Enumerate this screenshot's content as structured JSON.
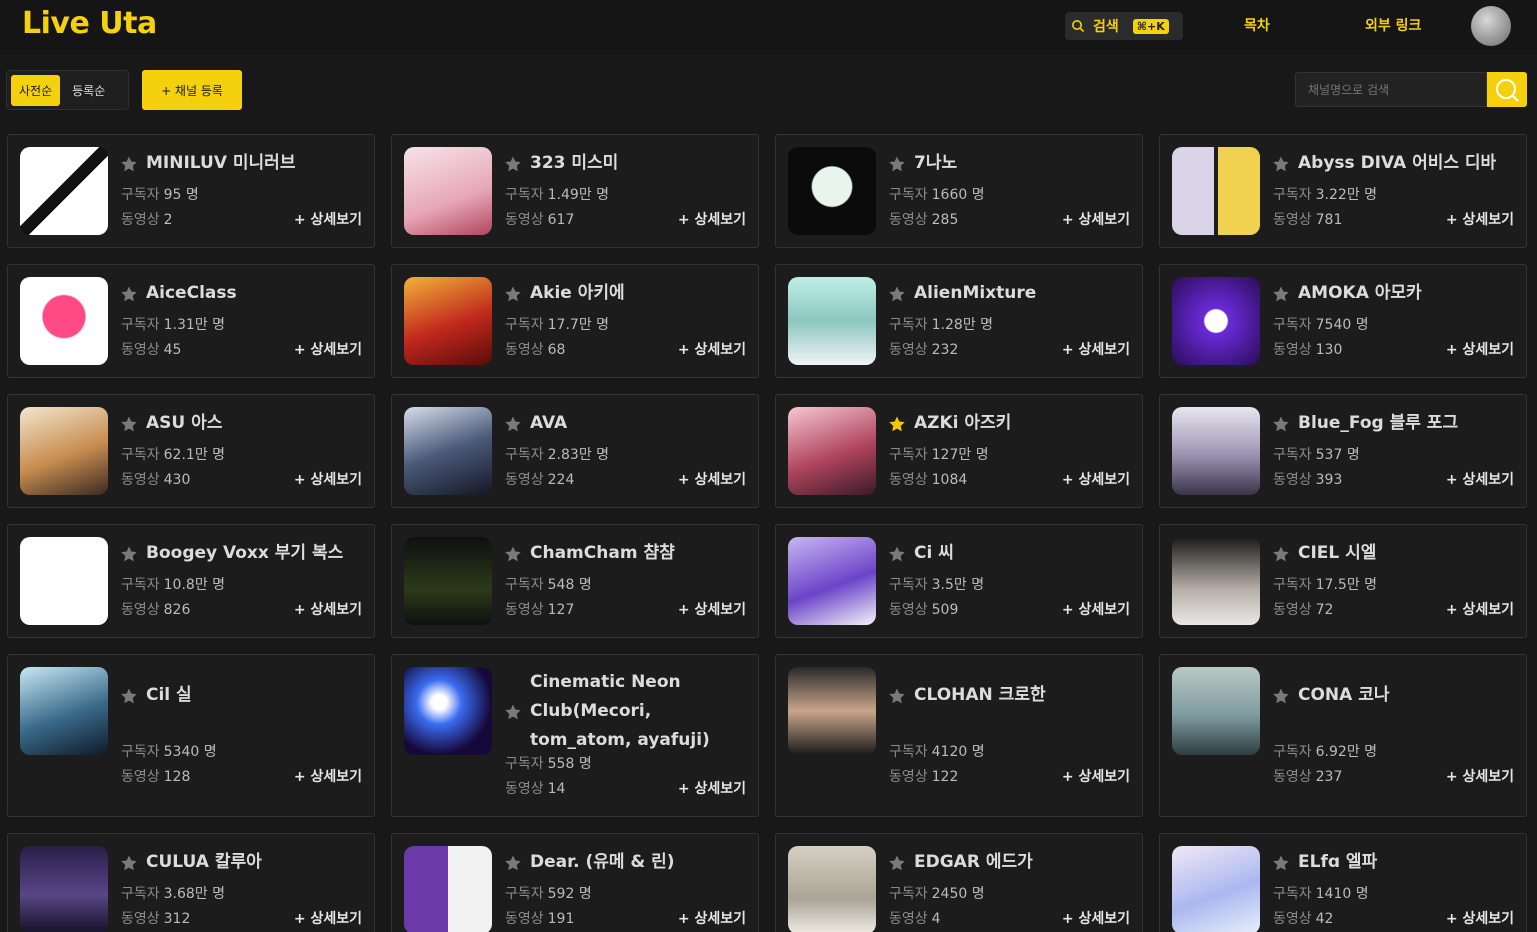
{
  "app": {
    "logo": "Live Uta",
    "search_label": "검색",
    "search_shortcut": "⌘+K",
    "nav_toc": "목차",
    "nav_external": "외부 링크"
  },
  "toolbar": {
    "sort_dictionary": "사전순",
    "sort_registered": "등록순",
    "add_channel": "+ 채널 등록",
    "search_placeholder": "채널명으로 검색"
  },
  "labels": {
    "subscribers": "구독자",
    "videos": "동영상",
    "detail": "+ 상세보기"
  },
  "colors": {
    "accent": "#f5d10d",
    "star_off": "#7a7a7a",
    "star_on": "#f5c60d"
  },
  "channels": [
    {
      "name": "MINILUV 미니러브",
      "subs": "95 명",
      "videos": "2",
      "fav": false
    },
    {
      "name": "323 미스미",
      "subs": "1.49만 명",
      "videos": "617",
      "fav": false
    },
    {
      "name": "7나노",
      "subs": "1660 명",
      "videos": "285",
      "fav": false
    },
    {
      "name": "Abyss DIVA 어비스 디바",
      "subs": "3.22만 명",
      "videos": "781",
      "fav": false
    },
    {
      "name": "AiceClass",
      "subs": "1.31만 명",
      "videos": "45",
      "fav": false
    },
    {
      "name": "Akie 아키에",
      "subs": "17.7만 명",
      "videos": "68",
      "fav": false
    },
    {
      "name": "AlienMixture",
      "subs": "1.28만 명",
      "videos": "232",
      "fav": false
    },
    {
      "name": "AMOKA 아모카",
      "subs": "7540 명",
      "videos": "130",
      "fav": false
    },
    {
      "name": "ASU 아스",
      "subs": "62.1만 명",
      "videos": "430",
      "fav": false
    },
    {
      "name": "AVA",
      "subs": "2.83만 명",
      "videos": "224",
      "fav": false
    },
    {
      "name": "AZKi 아즈키",
      "subs": "127만 명",
      "videos": "1084",
      "fav": true
    },
    {
      "name": "Blue_Fog 블루 포그",
      "subs": "537 명",
      "videos": "393",
      "fav": false
    },
    {
      "name": "Boogey Voxx 부기 복스",
      "subs": "10.8만 명",
      "videos": "826",
      "fav": false
    },
    {
      "name": "ChamCham 챰챰",
      "subs": "548 명",
      "videos": "127",
      "fav": false
    },
    {
      "name": "Ci 씨",
      "subs": "3.5만 명",
      "videos": "509",
      "fav": false
    },
    {
      "name": "CIEL 시엘",
      "subs": "17.5만 명",
      "videos": "72",
      "fav": false
    },
    {
      "name": "Cil 실",
      "subs": "5340 명",
      "videos": "128",
      "fav": false
    },
    {
      "name": "Cinematic Neon Club(Mecori, tom_atom, ayafuji)",
      "subs": "558 명",
      "videos": "14",
      "fav": false
    },
    {
      "name": "CLOHAN 크로한",
      "subs": "4120 명",
      "videos": "122",
      "fav": false
    },
    {
      "name": "CONA 코나",
      "subs": "6.92만 명",
      "videos": "237",
      "fav": false
    },
    {
      "name": "CULUA 칼루아",
      "subs": "3.68만 명",
      "videos": "312",
      "fav": false
    },
    {
      "name": "Dear. (유메 & 린)",
      "subs": "592 명",
      "videos": "191",
      "fav": false
    },
    {
      "name": "EDGAR 에드가",
      "subs": "2450 명",
      "videos": "4",
      "fav": false
    },
    {
      "name": "ELfɑ 엘파",
      "subs": "1410 명",
      "videos": "42",
      "fav": false
    }
  ]
}
